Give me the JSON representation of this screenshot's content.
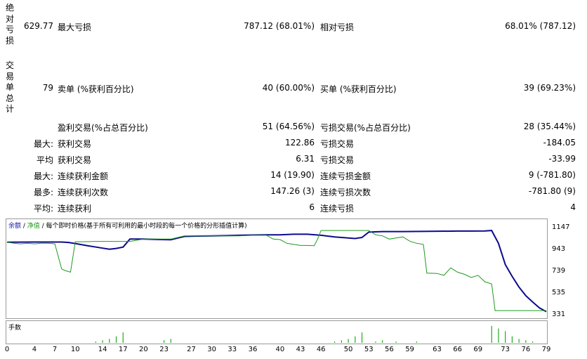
{
  "abs_dd": {
    "side_label": "绝对亏损",
    "value": "629.77",
    "max_dd_label": "最大亏损",
    "max_dd_value": "787.12 (68.01%)",
    "rel_dd_label": "相对亏损",
    "rel_dd_value": "68.01% (787.12)"
  },
  "trades": {
    "side_label": "交易单总计",
    "total": "79",
    "short_label": "卖单 (%获利百分比)",
    "short_value": "40 (60.00%)",
    "long_label": "买单 (%获利百分比)",
    "long_value": "39 (69.23%)"
  },
  "stats": {
    "profit_trades_label": "盈利交易(%占总百分比)",
    "profit_trades_value": "51 (64.56%)",
    "loss_trades_label": "亏损交易(%占总百分比)",
    "loss_trades_value": "28 (35.44%)",
    "rows": [
      {
        "prefix": "最大:",
        "l_label": "获利交易",
        "l_value": "122.86",
        "r_label": "亏损交易",
        "r_value": "-184.05"
      },
      {
        "prefix": "平均",
        "l_label": "获利交易",
        "l_value": "6.31",
        "r_label": "亏损交易",
        "r_value": "-33.99"
      },
      {
        "prefix": "最大:",
        "l_label": "连续获利金额",
        "l_value": "14 (19.90)",
        "r_label": "连续亏损金额",
        "r_value": "9 (-781.80)"
      },
      {
        "prefix": "最多:",
        "l_label": "连续获利次数",
        "l_value": "147.26 (3)",
        "r_label": "连续亏损次数",
        "r_value": "-781.80 (9)"
      },
      {
        "prefix": "平均:",
        "l_label": "连续获利",
        "l_value": "6",
        "r_label": "连续亏损",
        "r_value": "4"
      }
    ]
  },
  "chart_legend": {
    "balance": "余额",
    "sep1": " / ",
    "equity": "净值",
    "rest": " / 每个即时价格(基于所有可利用的最小时段的每一个价格的分形插值计算)"
  },
  "volume_label": "手数",
  "colors": {
    "balance": "#0b0b8c",
    "equity": "#1f9a1f",
    "volume": "#22aa22"
  },
  "chart_data": {
    "type": "line",
    "y_ticks": [
      1147,
      943,
      739,
      535,
      331
    ],
    "ylim": [
      331,
      1147
    ],
    "x_ticks": [
      0,
      4,
      7,
      10,
      14,
      17,
      20,
      23,
      27,
      30,
      33,
      36,
      40,
      43,
      46,
      50,
      53,
      56,
      59,
      63,
      66,
      69,
      73,
      76,
      79
    ],
    "xlim": [
      0,
      79
    ],
    "series": [
      {
        "key": "balance",
        "x": [
          0,
          4,
          8,
          9,
          10,
          12,
          14,
          15,
          16,
          17,
          18,
          20,
          22,
          24,
          26,
          28,
          30,
          32,
          34,
          36,
          38,
          40,
          42,
          44,
          46,
          48,
          50,
          51,
          52,
          53,
          55,
          58,
          62,
          66,
          68,
          70,
          71,
          72,
          73,
          74,
          75,
          76,
          77,
          78,
          79
        ],
        "y": [
          1010,
          1012,
          1012,
          1008,
          998,
          975,
          955,
          945,
          952,
          965,
          1040,
          1040,
          1036,
          1034,
          1065,
          1068,
          1070,
          1072,
          1075,
          1078,
          1080,
          1080,
          1085,
          1085,
          1075,
          1060,
          1050,
          1045,
          1055,
          1105,
          1110,
          1110,
          1112,
          1115,
          1115,
          1116,
          1120,
          1000,
          800,
          690,
          590,
          510,
          450,
          395,
          360
        ]
      },
      {
        "key": "equity",
        "x": [
          0,
          1,
          2,
          3,
          4,
          5,
          6,
          7,
          8,
          8.5,
          9.3,
          10,
          11,
          13,
          14,
          15,
          16,
          17,
          18,
          20,
          22,
          24,
          26,
          28,
          30,
          32,
          34,
          36,
          38,
          39,
          40,
          41,
          42,
          43,
          44,
          45,
          45.5,
          46,
          48,
          50,
          52,
          53,
          54,
          55,
          56,
          57,
          58,
          59,
          60,
          61,
          61.5,
          62,
          63,
          64,
          65,
          66,
          67,
          68,
          69,
          70,
          71,
          71.5,
          72,
          73,
          74,
          75,
          76,
          77,
          78,
          79
        ],
        "y": [
          1010,
          1000,
          995,
          1000,
          995,
          1000,
          1000,
          995,
          760,
          745,
          730,
          1015,
          1015,
          1018,
          1018,
          1018,
          1018,
          1018,
          1018,
          1040,
          1040,
          1040,
          1070,
          1070,
          1070,
          1070,
          1070,
          1075,
          1075,
          1040,
          1035,
          1000,
          990,
          980,
          980,
          978,
          1040,
          1120,
          1120,
          1120,
          1120,
          1120,
          1080,
          1070,
          1040,
          1050,
          1060,
          1020,
          1000,
          990,
          720,
          720,
          718,
          700,
          770,
          730,
          710,
          680,
          700,
          640,
          620,
          370,
          370,
          370,
          370,
          370,
          370,
          370,
          370,
          370
        ]
      }
    ],
    "volume": {
      "x": [
        13,
        14,
        15,
        16,
        17,
        23,
        24,
        48,
        49,
        50,
        51,
        52,
        54,
        55,
        57,
        60,
        71,
        72,
        73,
        74,
        75,
        76,
        77
      ],
      "v": [
        1,
        2,
        3,
        5,
        8,
        2,
        3,
        1,
        2,
        3,
        5,
        8,
        1,
        2,
        1,
        1,
        13,
        11,
        9,
        5,
        3,
        2,
        1
      ],
      "max": 14
    }
  }
}
